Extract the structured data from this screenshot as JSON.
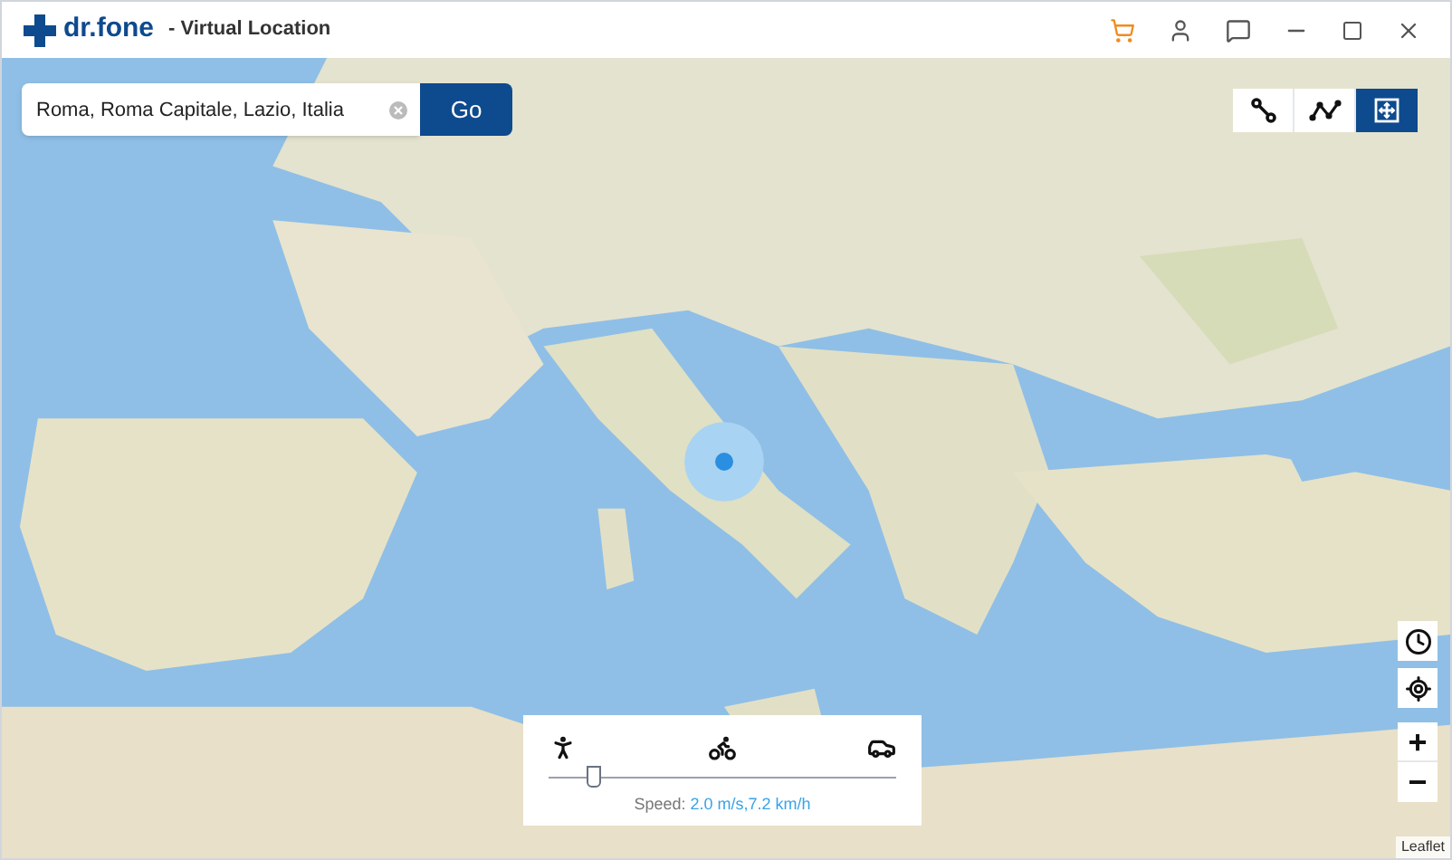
{
  "window": {
    "app_name": "dr.fone",
    "title": "- Virtual Location"
  },
  "search": {
    "value": "Roma, Roma Capitale, Lazio, Italia",
    "button": "Go"
  },
  "modes": [
    {
      "kind": "teleport-two",
      "selected": false
    },
    {
      "kind": "multi-stop",
      "selected": false
    },
    {
      "kind": "teleport",
      "selected": true
    }
  ],
  "speed_panel": {
    "transports": [
      {
        "kind": "walk"
      },
      {
        "kind": "bike"
      },
      {
        "kind": "car"
      }
    ],
    "level": 0.13,
    "label": "Speed:",
    "value": "2.0 m/s,7.2 km/h"
  },
  "zoom": {
    "in": "+",
    "out": "−"
  },
  "attribution": "Leaflet"
}
